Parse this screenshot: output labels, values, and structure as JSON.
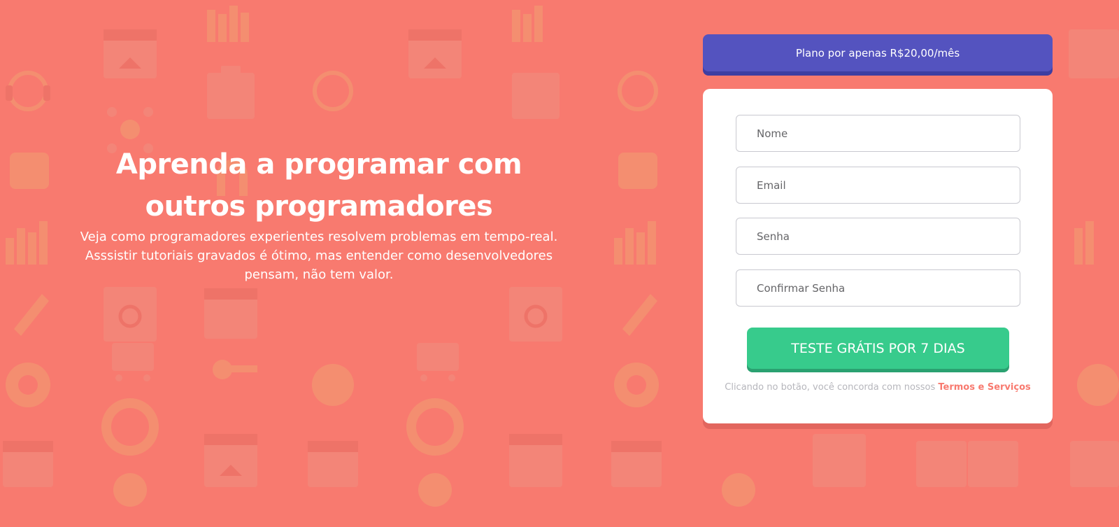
{
  "hero": {
    "title": "Aprenda a programar com outros programadores",
    "description": "Veja como programadores experientes resolvem problemas em tempo-real. Asssistir tutoriais gravados é ótimo, mas entender como desenvolvedores pensam, não tem valor."
  },
  "plan": {
    "banner": "Plano por apenas R$20,00/mês"
  },
  "form": {
    "name_placeholder": "Nome",
    "email_placeholder": "Email",
    "password_placeholder": "Senha",
    "confirm_password_placeholder": "Confirmar Senha",
    "submit_label": "TESTE GRÁTIS POR 7 DIAS",
    "terms_text": "Clicando no botão, você concorda com nossos",
    "terms_link": "Termos e Serviços"
  },
  "colors": {
    "background": "#f87a6f",
    "banner": "#5453bf",
    "cta": "#37cb8c",
    "link": "#f87a6f",
    "card": "#ffffff"
  },
  "icons": [
    "browser-home-icon",
    "bar-chart-icon",
    "headset-icon",
    "toolbox-icon",
    "network-icon",
    "thumbs-up-icon",
    "magnet-icon",
    "rocket-icon",
    "search-window-icon",
    "cart-icon",
    "gear-icon",
    "key-icon",
    "lifebuoy-icon",
    "calendar-icon",
    "lightbulb-icon"
  ]
}
